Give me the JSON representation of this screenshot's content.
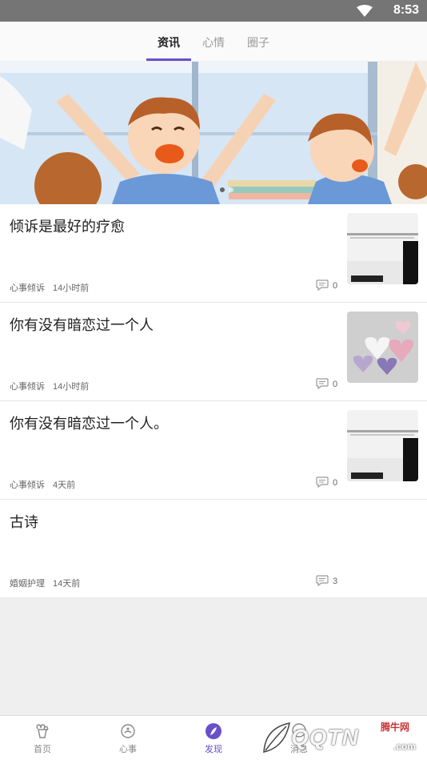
{
  "status_bar": {
    "time": "8:53"
  },
  "top_tabs": [
    {
      "label": "资讯",
      "active": true
    },
    {
      "label": "心情",
      "active": false
    },
    {
      "label": "圈子",
      "active": false
    }
  ],
  "banner": {
    "slides": 2,
    "active_slide": 0
  },
  "articles": [
    {
      "title": "倾诉是最好的疗愈",
      "category": "心事倾诉",
      "time": "14小时前",
      "comments": "0",
      "thumb": "paper-note-image"
    },
    {
      "title": "你有没有暗恋过一个人",
      "category": "心事倾诉",
      "time": "14小时前",
      "comments": "0",
      "thumb": "heart-candy-image"
    },
    {
      "title": "你有没有暗恋过一个人。",
      "category": "心事倾诉",
      "time": "4天前",
      "comments": "0",
      "thumb": "paper-note-image"
    },
    {
      "title": "古诗",
      "category": "婚姻护理",
      "time": "14天前",
      "comments": "3",
      "thumb": null
    }
  ],
  "bottom_nav": [
    {
      "label": "首页",
      "icon": "home-icon",
      "active": false
    },
    {
      "label": "心事",
      "icon": "heart-chat-icon",
      "active": false
    },
    {
      "label": "发现",
      "icon": "compass-icon",
      "active": true
    },
    {
      "label": "消息",
      "icon": "message-icon",
      "active": false
    }
  ],
  "watermark": {
    "brand": "QQTN",
    "site": "腾牛网",
    "domain": ".com"
  },
  "colors": {
    "accent": "#6b4fc9",
    "status_bar": "#757575",
    "background": "#efefef"
  }
}
